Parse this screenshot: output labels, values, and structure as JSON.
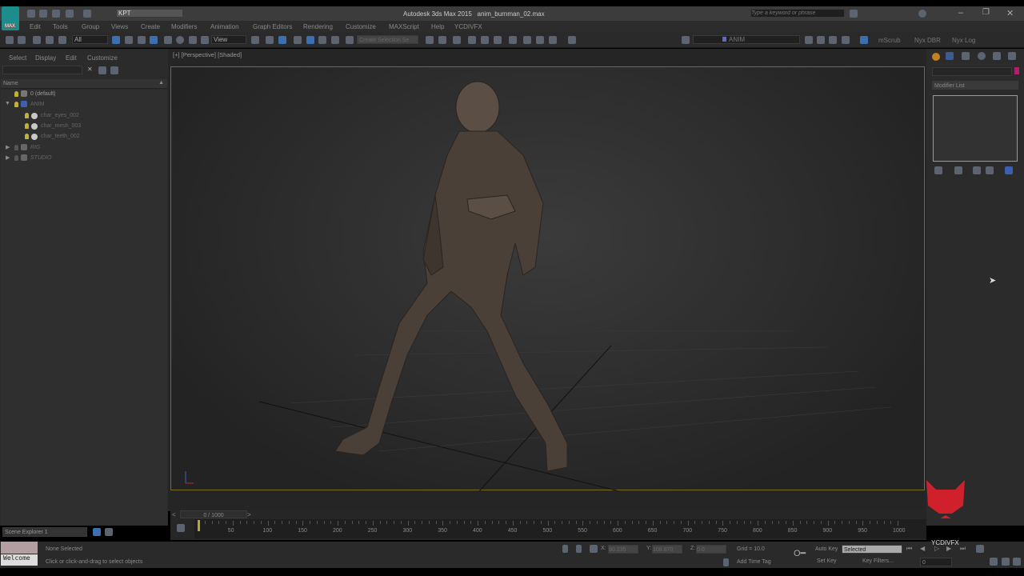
{
  "title": {
    "app": "Autodesk 3ds Max 2015",
    "file": "anim_burnman_02.max",
    "workspace": "KPT",
    "search_placeholder": "Type a keyword or phrase",
    "logo": "MAX"
  },
  "menu": [
    "Edit",
    "Tools",
    "Group",
    "Views",
    "Create",
    "Modifiers",
    "Animation",
    "Graph Editors",
    "Rendering",
    "Customize",
    "MAXScript",
    "Help",
    "YCDIVFX"
  ],
  "toolbar": {
    "filter": "All",
    "ref_coord": "View",
    "selection_set": "Create Selection Se",
    "layer": "ANIM",
    "extras": [
      "mScrub",
      "Nyx DBR",
      "Nyx Log"
    ]
  },
  "explorer": {
    "tabs": [
      "Select",
      "Display",
      "Edit",
      "Customize"
    ],
    "column": "Name",
    "items": [
      {
        "label": "0 (default)",
        "level": 0,
        "kind": "layer"
      },
      {
        "label": "ANIM",
        "level": 0,
        "kind": "layer",
        "expanded": true
      },
      {
        "label": "char_eyes_002",
        "level": 1,
        "kind": "object"
      },
      {
        "label": "char_mesh_003",
        "level": 1,
        "kind": "object"
      },
      {
        "label": "char_teeth_002",
        "level": 1,
        "kind": "object"
      },
      {
        "label": "RIG",
        "level": 0,
        "kind": "layer"
      },
      {
        "label": "STUDIO",
        "level": 0,
        "kind": "layer"
      }
    ],
    "footer": "Scene Explorer 1"
  },
  "viewport": {
    "label": "[+] [Perspective] [Shaded]"
  },
  "command_panel": {
    "modifier_list": "Modifier List",
    "accent": "#b0206a"
  },
  "timeline": {
    "slider": "0 / 1000",
    "current": 0,
    "start": 0,
    "end": 1000,
    "labels": [
      0,
      50,
      100,
      150,
      200,
      250,
      300,
      350,
      400,
      450,
      500,
      550,
      600,
      650,
      700,
      750,
      800,
      850,
      900,
      950,
      1000
    ]
  },
  "status": {
    "maxscript": "Welcome",
    "selection": "None Selected",
    "prompt": "Click or click-and-drag to select objects",
    "x": "90.235",
    "y": "108.870",
    "z": "0.0",
    "grid": "Grid = 10.0",
    "add_time_tag": "Add Time Tag",
    "auto_key": "Auto Key",
    "key_mode": "Selected",
    "set_key": "Set Key",
    "key_filters": "Key Filters...",
    "frame": "0"
  },
  "watermark": "YCDIVFX"
}
